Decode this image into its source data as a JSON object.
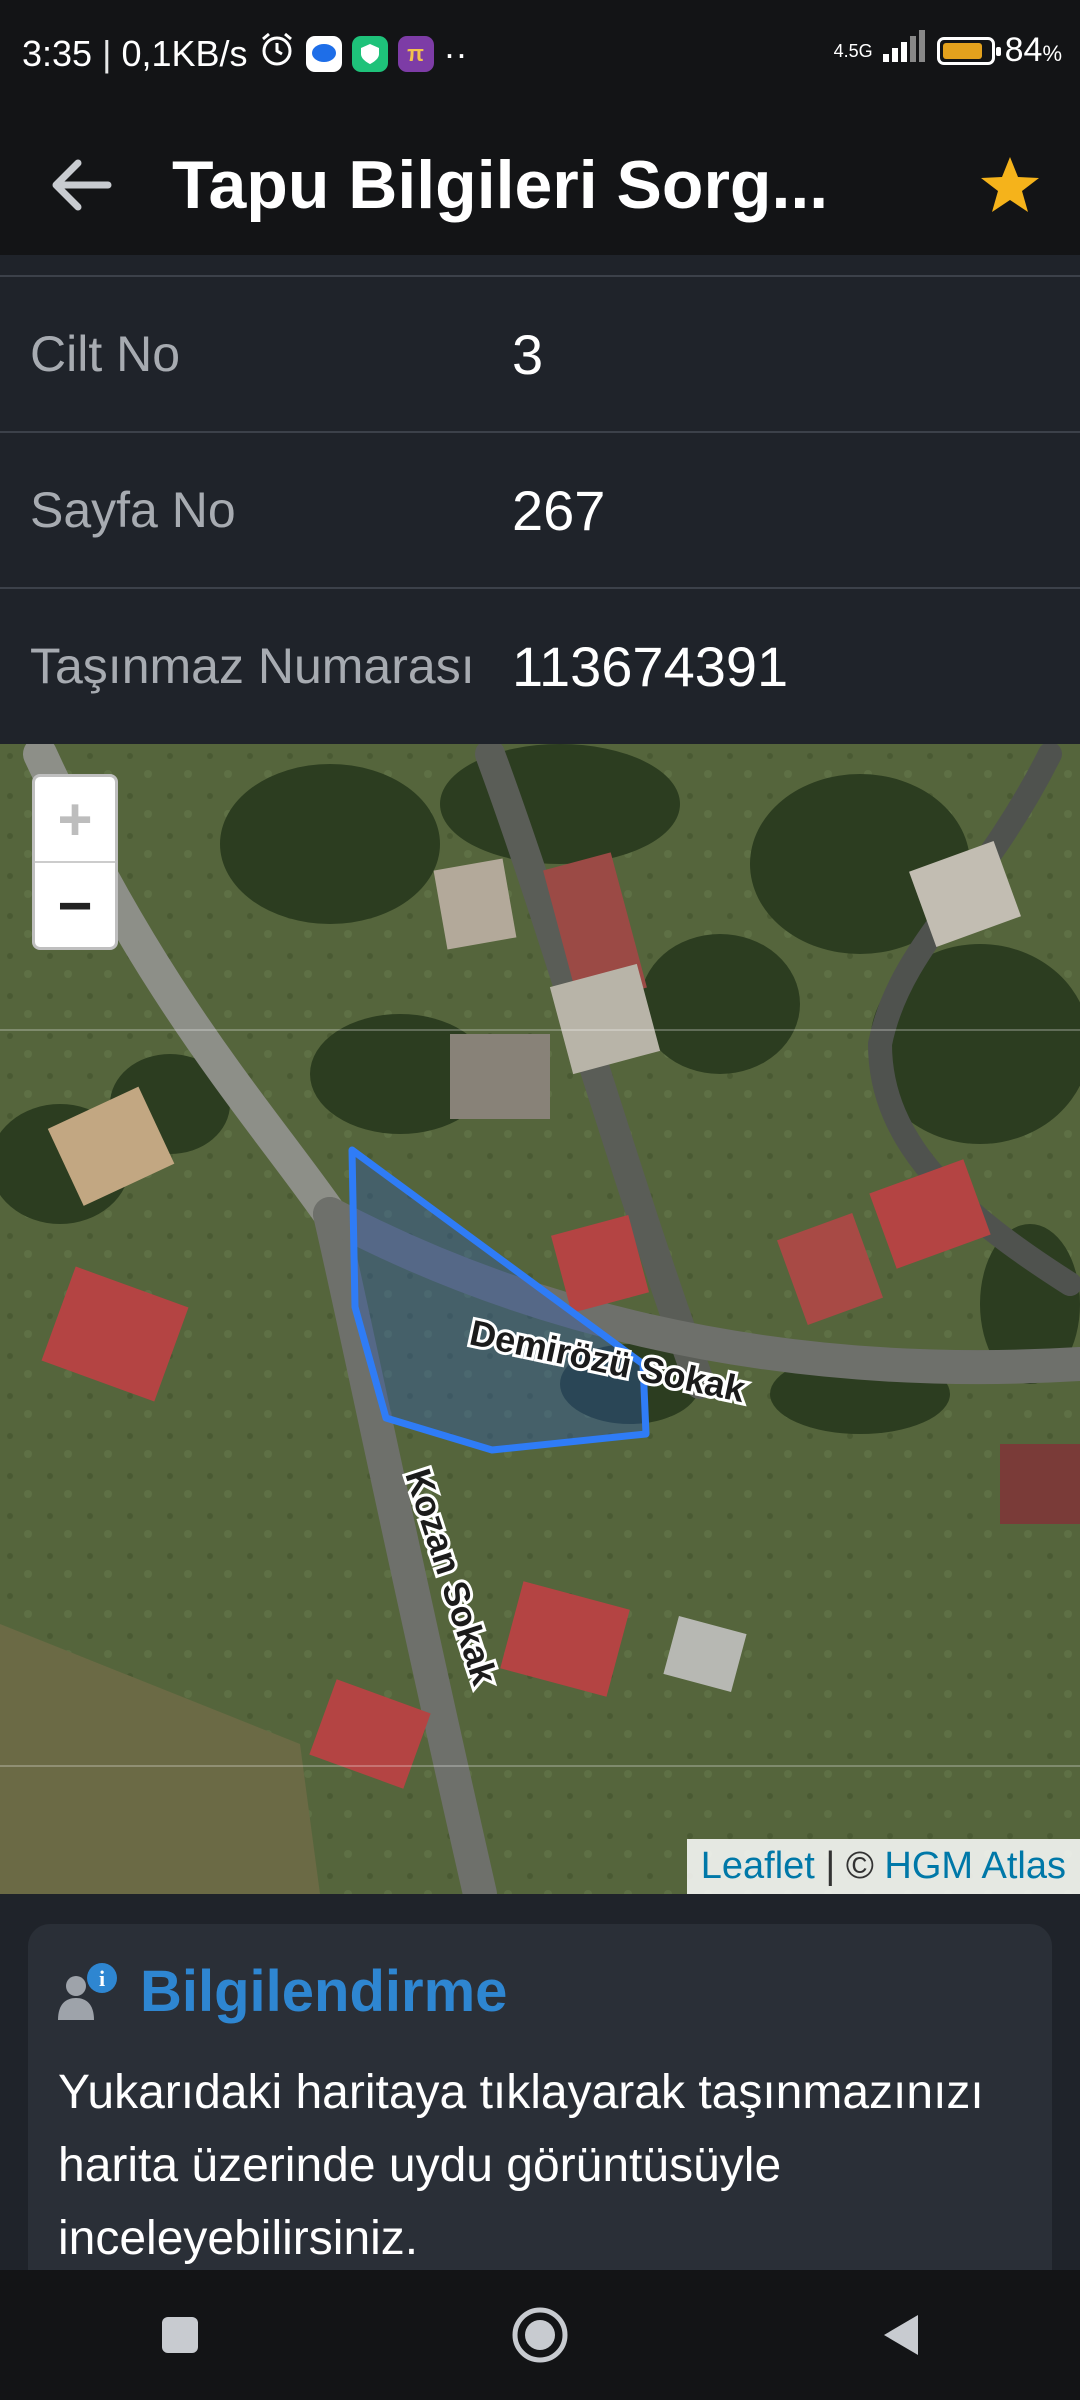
{
  "status": {
    "time": "3:35",
    "net_speed": "0,1KB/s",
    "signal": "4.5G",
    "battery": "84",
    "battery_level_fraction": 0.84
  },
  "app_bar": {
    "title": "Tapu Bilgileri Sorg...",
    "star_color": "#f5b31b"
  },
  "rows": [
    {
      "label": "Cilt No",
      "value": "3"
    },
    {
      "label": "Sayfa No",
      "value": "267"
    },
    {
      "label": "Taşınmaz Numarası",
      "value": "113674391"
    }
  ],
  "map": {
    "zoom_in": "+",
    "zoom_out": "−",
    "street_1": "Demirözü Sokak",
    "street_2": "Kozan Sokak",
    "attribution_leaflet": "Leaflet",
    "attribution_sep": " | © ",
    "attribution_hgm": "HGM Atlas",
    "parcel_color": "#2f7cf6"
  },
  "info_card": {
    "title": "Bilgilendirme",
    "body": "Yukarıdaki haritaya tıklayarak taşınmazınızı harita üzerinde uydu görüntüsüyle inceleyebilirsiniz.",
    "accent": "#2e86d1"
  }
}
